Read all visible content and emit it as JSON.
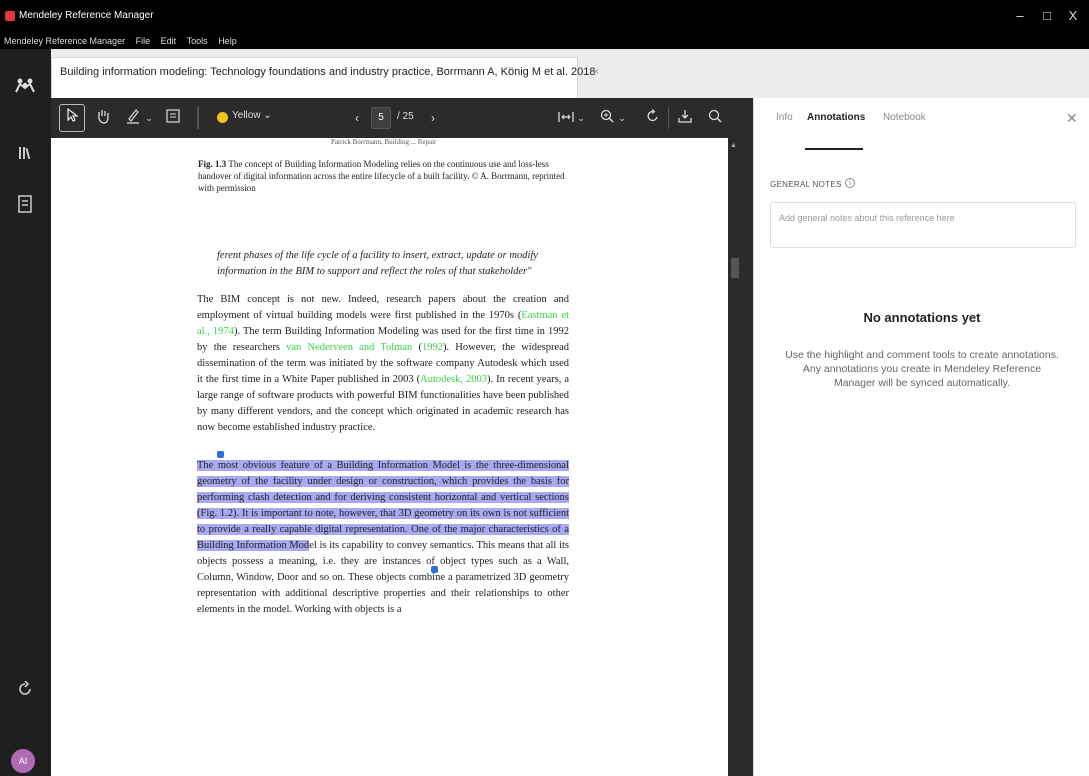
{
  "window": {
    "title": "Mendeley Reference Manager",
    "controls": {
      "minimize": "–",
      "maximize": "□",
      "close": "X"
    }
  },
  "menubar": [
    "Mendeley Reference Manager",
    "File",
    "Edit",
    "Tools",
    "Help"
  ],
  "tab": {
    "title": "Building information modeling: Technology foundations and industry practice, Borrmann A, König M et al. 2018",
    "close_glyph": "×"
  },
  "toolbar": {
    "highlight_color_label": "Yellow",
    "highlight_color_hex": "#f5c518",
    "page_current": "5",
    "page_total": "/ 25"
  },
  "document": {
    "running_header": "Patrick Borrmann, Building ... Repair",
    "caption_label": "Fig. 1.3",
    "caption_text": " The concept of Building Information Modeling relies on the continuous use and loss-less handover of digital information across the entire lifecycle of a built facility. © A. Borrmann, reprinted with permission",
    "quote": "ferent phases of the life cycle of a facility to insert, extract, update or modify information in the BIM to support and reflect the roles of that stakeholder\"",
    "para1": {
      "t1": "The BIM concept is not new. Indeed, research papers about the creation and employment of virtual building models were first published in the 1970s (",
      "c1": "Eastman et al., 1974",
      "t2": "). The term Building Information Modeling was used for the first time in 1992 by the researchers ",
      "c2": "van Nederveen and Tolman",
      "t3": " (",
      "c3": "1992",
      "t4": "). However, the widespread dissemination of the term was initiated by the software company Autodesk which used it the first time in a White Paper published in 2003 (",
      "c4": "Autodesk, 2003",
      "t5": "). In recent years, a large range of software products with powerful BIM functionalities have been published by many different vendors, and the concept which originated in academic research has now become established industry practice."
    },
    "para2": {
      "h1": "The most obvious feature of a Building Information Model is the three-dimensional geometry of the facility under design or construction, which provides the basis for performing clash detection and for deriving consistent horizontal and vertical sections (Fig. 1.2). It is important to note, however, that 3D geometry on its own is not sufficient to provide a really capable digital representation. One of the major characteristics of a Building Information Mod",
      "t1": "el is its capability to convey semantics. This means that all its objects possess a meaning, i.e. they are instances of object types such as a Wall, Column, Window, Door and so on. These objects combine a parametrized 3D geometry representation with additional descriptive properties and their relationships to other elements in the model. Working with objects is a"
    },
    "highlight_color_hex": "#a9a9f2",
    "citation_color_hex": "#3bcf48"
  },
  "panel": {
    "tabs": [
      "Info",
      "Annotations",
      "Notebook"
    ],
    "active_tab": "Annotations",
    "general_notes_label": "GENERAL NOTES",
    "general_notes_placeholder": "Add general notes about this reference here",
    "empty_title": "No annotations yet",
    "empty_line1": "Use the highlight and comment tools to create annotations.",
    "empty_line2": "Any annotations you create in Mendeley Reference Manager will be synced automatically."
  },
  "user": {
    "initials": "AI",
    "avatar_color": "#b06ab3"
  }
}
